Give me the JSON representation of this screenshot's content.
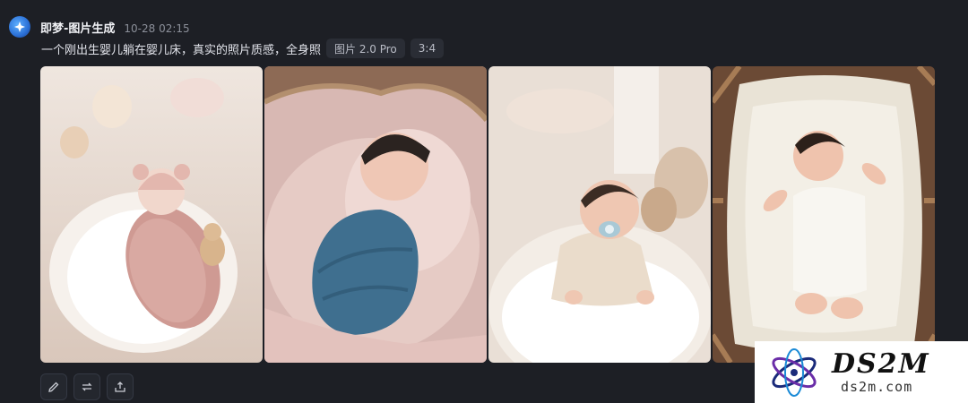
{
  "header": {
    "app_name": "即梦-图片生成",
    "timestamp": "10-28  02:15"
  },
  "prompt": {
    "text": "一个刚出生婴儿躺在婴儿床，真实的照片质感，全身照",
    "model_chip": "图片 2.0 Pro",
    "ratio_chip": "3:4"
  },
  "images": [
    {
      "alt": "pink-wrapped newborn with knitted bear hat in white nest"
    },
    {
      "alt": "sleeping newborn swaddled in blue blanket in basket"
    },
    {
      "alt": "baby with pacifier sitting in cream cushion"
    },
    {
      "alt": "newborn in white onesie sleeping in wooden crib"
    }
  ],
  "toolbar": {
    "buttons": [
      {
        "icon": "edit-icon"
      },
      {
        "icon": "regenerate-icon"
      },
      {
        "icon": "share-icon"
      }
    ]
  },
  "watermark": {
    "title": "DS2M",
    "subtitle": "ds2m.com"
  },
  "colors": {
    "background": "#1d1f25",
    "chip": "#2a2d35",
    "accent": "#2a6fd6"
  }
}
